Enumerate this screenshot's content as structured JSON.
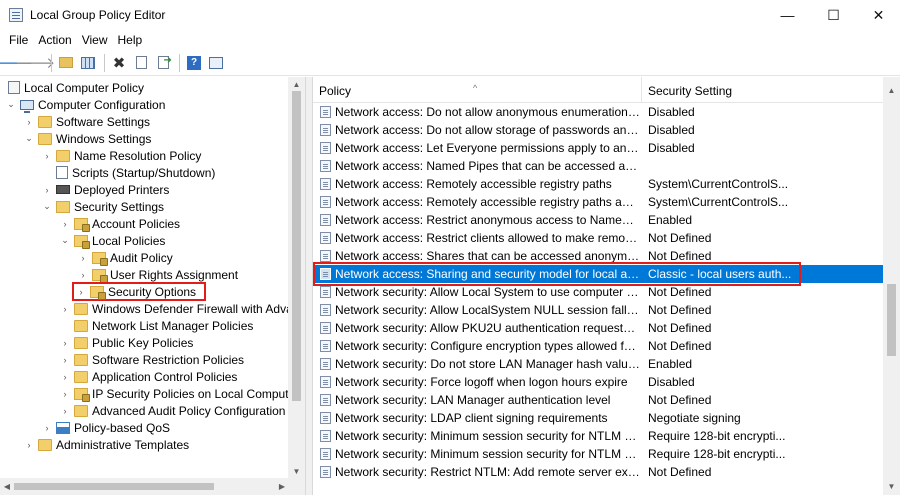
{
  "window": {
    "title": "Local Group Policy Editor",
    "minimize_glyph": "—",
    "maximize_glyph": "☐",
    "close_glyph": "✕"
  },
  "menu": [
    "File",
    "Action",
    "View",
    "Help"
  ],
  "toolbar_icons": [
    "back-arrow-icon",
    "forward-arrow-icon",
    "up-folder-icon",
    "show-hide-tree-icon",
    "delete-icon",
    "properties-icon",
    "export-list-icon",
    "help-icon",
    "extended-view-icon"
  ],
  "tree": {
    "items": [
      {
        "label": "Local Computer Policy",
        "icon": "policy-icon"
      },
      {
        "label": "Computer Configuration",
        "icon": "computer-icon"
      },
      {
        "label": "Software Settings",
        "icon": "folder-icon"
      },
      {
        "label": "Windows Settings",
        "icon": "folder-icon"
      },
      {
        "label": "Name Resolution Policy",
        "icon": "folder-icon"
      },
      {
        "label": "Scripts (Startup/Shutdown)",
        "icon": "script-icon"
      },
      {
        "label": "Deployed Printers",
        "icon": "printer-icon"
      },
      {
        "label": "Security Settings",
        "icon": "security-icon"
      },
      {
        "label": "Account Policies",
        "icon": "folder-lock-icon"
      },
      {
        "label": "Local Policies",
        "icon": "folder-lock-icon"
      },
      {
        "label": "Audit Policy",
        "icon": "folder-lock-icon"
      },
      {
        "label": "User Rights Assignment",
        "icon": "folder-lock-icon"
      },
      {
        "label": "Security Options",
        "icon": "folder-lock-icon"
      },
      {
        "label": "Windows Defender Firewall with Advanc",
        "icon": "folder-icon"
      },
      {
        "label": "Network List Manager Policies",
        "icon": "folder-icon"
      },
      {
        "label": "Public Key Policies",
        "icon": "folder-icon"
      },
      {
        "label": "Software Restriction Policies",
        "icon": "folder-icon"
      },
      {
        "label": "Application Control Policies",
        "icon": "folder-icon"
      },
      {
        "label": "IP Security Policies on Local Computer",
        "icon": "folder-lock-icon"
      },
      {
        "label": "Advanced Audit Policy Configuration",
        "icon": "folder-icon"
      },
      {
        "label": "Policy-based QoS",
        "icon": "chart-icon"
      },
      {
        "label": "Administrative Templates",
        "icon": "folder-icon"
      }
    ]
  },
  "list": {
    "headers": {
      "policy": "Policy",
      "setting": "Security Setting"
    },
    "rows": [
      {
        "policy": "Network access: Do not allow anonymous enumeration of S...",
        "setting": "Disabled"
      },
      {
        "policy": "Network access: Do not allow storage of passwords and cre...",
        "setting": "Disabled"
      },
      {
        "policy": "Network access: Let Everyone permissions apply to anonym...",
        "setting": "Disabled"
      },
      {
        "policy": "Network access: Named Pipes that can be accessed anonym...",
        "setting": ""
      },
      {
        "policy": "Network access: Remotely accessible registry paths",
        "setting": "System\\CurrentControlS..."
      },
      {
        "policy": "Network access: Remotely accessible registry paths and sub...",
        "setting": "System\\CurrentControlS..."
      },
      {
        "policy": "Network access: Restrict anonymous access to Named Pipes...",
        "setting": "Enabled"
      },
      {
        "policy": "Network access: Restrict clients allowed to make remote call...",
        "setting": "Not Defined"
      },
      {
        "policy": "Network access: Shares that can be accessed anonymously",
        "setting": "Not Defined"
      },
      {
        "policy": "Network access: Sharing and security model for local accou...",
        "setting": "Classic - local users auth..."
      },
      {
        "policy": "Network security: Allow Local System to use computer ident...",
        "setting": "Not Defined"
      },
      {
        "policy": "Network security: Allow LocalSystem NULL session fallback",
        "setting": "Not Defined"
      },
      {
        "policy": "Network security: Allow PKU2U authentication requests to t...",
        "setting": "Not Defined"
      },
      {
        "policy": "Network security: Configure encryption types allowed for Ke...",
        "setting": "Not Defined"
      },
      {
        "policy": "Network security: Do not store LAN Manager hash value on ...",
        "setting": "Enabled"
      },
      {
        "policy": "Network security: Force logoff when logon hours expire",
        "setting": "Disabled"
      },
      {
        "policy": "Network security: LAN Manager authentication level",
        "setting": "Not Defined"
      },
      {
        "policy": "Network security: LDAP client signing requirements",
        "setting": "Negotiate signing"
      },
      {
        "policy": "Network security: Minimum session security for NTLM SSP ...",
        "setting": "Require 128-bit encrypti..."
      },
      {
        "policy": "Network security: Minimum session security for NTLM SSP ...",
        "setting": "Require 128-bit encrypti..."
      },
      {
        "policy": "Network security: Restrict NTLM: Add remote server excepti...",
        "setting": "Not Defined"
      }
    ]
  },
  "colors": {
    "selection": "#0078d7",
    "highlight_outline": "#e21b1b",
    "folder": "#f2cf6b"
  }
}
